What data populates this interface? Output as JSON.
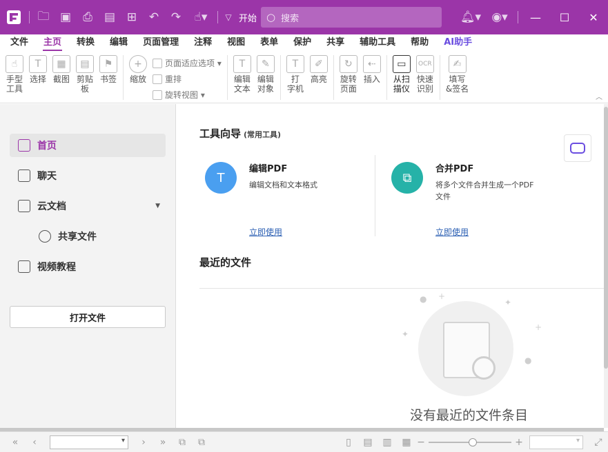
{
  "titlebar": {
    "start_label": "开始",
    "search_placeholder": "搜索"
  },
  "menu": {
    "tabs": [
      "文件",
      "主页",
      "转换",
      "编辑",
      "页面管理",
      "注释",
      "视图",
      "表单",
      "保护",
      "共享",
      "辅助工具",
      "帮助",
      "AI助手"
    ],
    "active": "主页"
  },
  "ribbon": {
    "hand": "手型\n工具",
    "select": "选择",
    "snapshot": "截图",
    "clipboard": "剪贴\n板",
    "bookmark": "书签",
    "zoom": "缩放",
    "fit_page": "页面适应选项",
    "reflow": "重排",
    "rotate_view": "旋转视图",
    "edit_text": "编辑\n文本",
    "edit_object": "编辑\n对象",
    "typewriter": "打\n字机",
    "highlight": "高亮",
    "rotate_page": "旋转\n页面",
    "insert": "插入",
    "from_scanner": "从扫\n描仪",
    "quick_ocr": "快速\n识别",
    "fill_sign": "填写\n&签名"
  },
  "sidebar": {
    "items": [
      {
        "label": "首页",
        "icon": "home-icon"
      },
      {
        "label": "聊天",
        "icon": "chat-icon"
      },
      {
        "label": "云文档",
        "icon": "cloud-doc-icon"
      },
      {
        "label": "共享文件",
        "icon": "cloud-share-icon"
      },
      {
        "label": "视频教程",
        "icon": "video-icon"
      }
    ],
    "open_file": "打开文件"
  },
  "main": {
    "tools_title": "工具向导",
    "tools_subtitle": "(常用工具)",
    "cards": [
      {
        "title": "编辑PDF",
        "desc": "编辑文档和文本格式",
        "link": "立即使用",
        "color": "#4a9ff0"
      },
      {
        "title": "合并PDF",
        "desc": "将多个文件合并生成一个PDF\n文件",
        "link": "立即使用",
        "color": "#26b2a8"
      }
    ],
    "recent_title": "最近的文件",
    "empty_text": "没有最近的文件条目"
  },
  "colors": {
    "accent": "#9b35a8",
    "ai": "#6a4de0",
    "link": "#2b5fb3"
  }
}
